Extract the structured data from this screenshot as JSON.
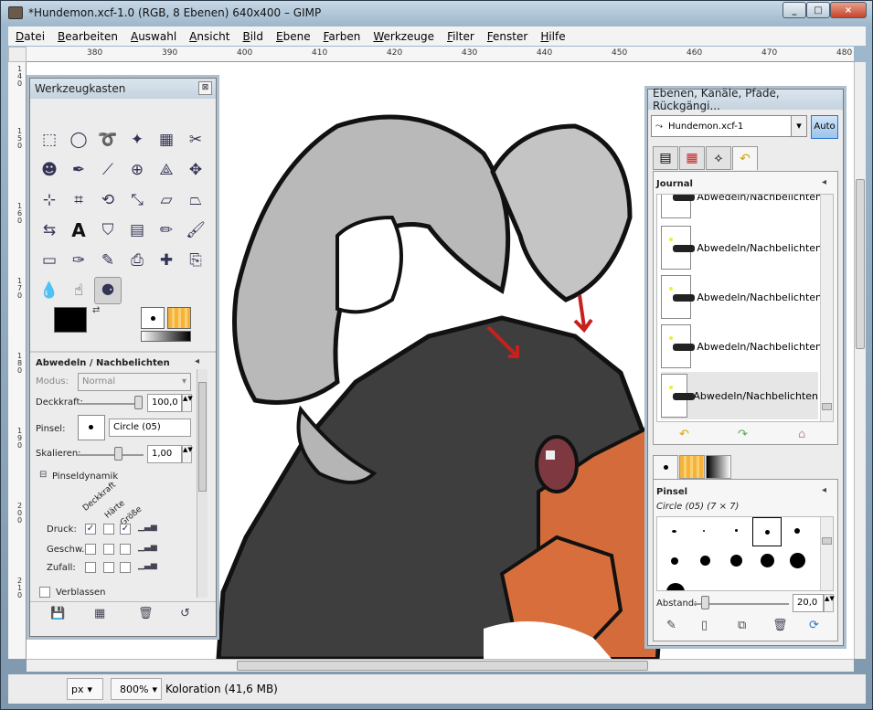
{
  "window": {
    "title": "*Hundemon.xcf-1.0 (RGB, 8 Ebenen) 640x400 – GIMP",
    "controls": [
      "_",
      "□",
      "×"
    ]
  },
  "menu": [
    "Datei",
    "Bearbeiten",
    "Auswahl",
    "Ansicht",
    "Bild",
    "Ebene",
    "Farben",
    "Werkzeuge",
    "Filter",
    "Fenster",
    "Hilfe"
  ],
  "ruler": {
    "top": [
      "380",
      "390",
      "400",
      "410",
      "420",
      "430",
      "440",
      "450",
      "460",
      "470",
      "480"
    ],
    "left": [
      "140",
      "150",
      "160",
      "170",
      "180",
      "190",
      "200",
      "210",
      "220",
      "230"
    ]
  },
  "toolbox": {
    "title": "Werkzeugkasten",
    "tool_options_title": "Abwedeln / Nachbelichten",
    "mode_label": "Modus:",
    "mode_value": "Normal",
    "opacity_label": "Deckkraft:",
    "opacity_value": "100,0",
    "brush_label": "Pinsel:",
    "brush_value": "Circle (05)",
    "scale_label": "Skalieren:",
    "scale_value": "1,00",
    "dynamics_title": "Pinseldynamik",
    "dyn_cols": [
      "Deckkraft",
      "Härte",
      "Größe"
    ],
    "dyn_rows": [
      "Druck:",
      "Geschw.:",
      "Zufall:"
    ],
    "fade_label": "Verblassen"
  },
  "layers": {
    "title": "Ebenen, Kanäle, Pfade, Rückgängi...",
    "image_select": "Hundemon.xcf-1",
    "auto_label": "Auto",
    "journal_title": "Journal",
    "journal_items": [
      "Abwedeln/Nachbelichten",
      "Abwedeln/Nachbelichten",
      "Abwedeln/Nachbelichten",
      "Abwedeln/Nachbelichten",
      "Abwedeln/Nachbelichten"
    ],
    "brushes_title": "Pinsel",
    "brush_name": "Circle (05) (7 × 7)",
    "spacing_label": "Abstand:",
    "spacing_value": "20,0"
  },
  "status": {
    "unit": "px",
    "zoom": "800%",
    "info": "Koloration (41,6 MB)"
  },
  "colors": {
    "accent": "#2d74c9",
    "fg": "#000000",
    "bg": "#ffffff"
  }
}
